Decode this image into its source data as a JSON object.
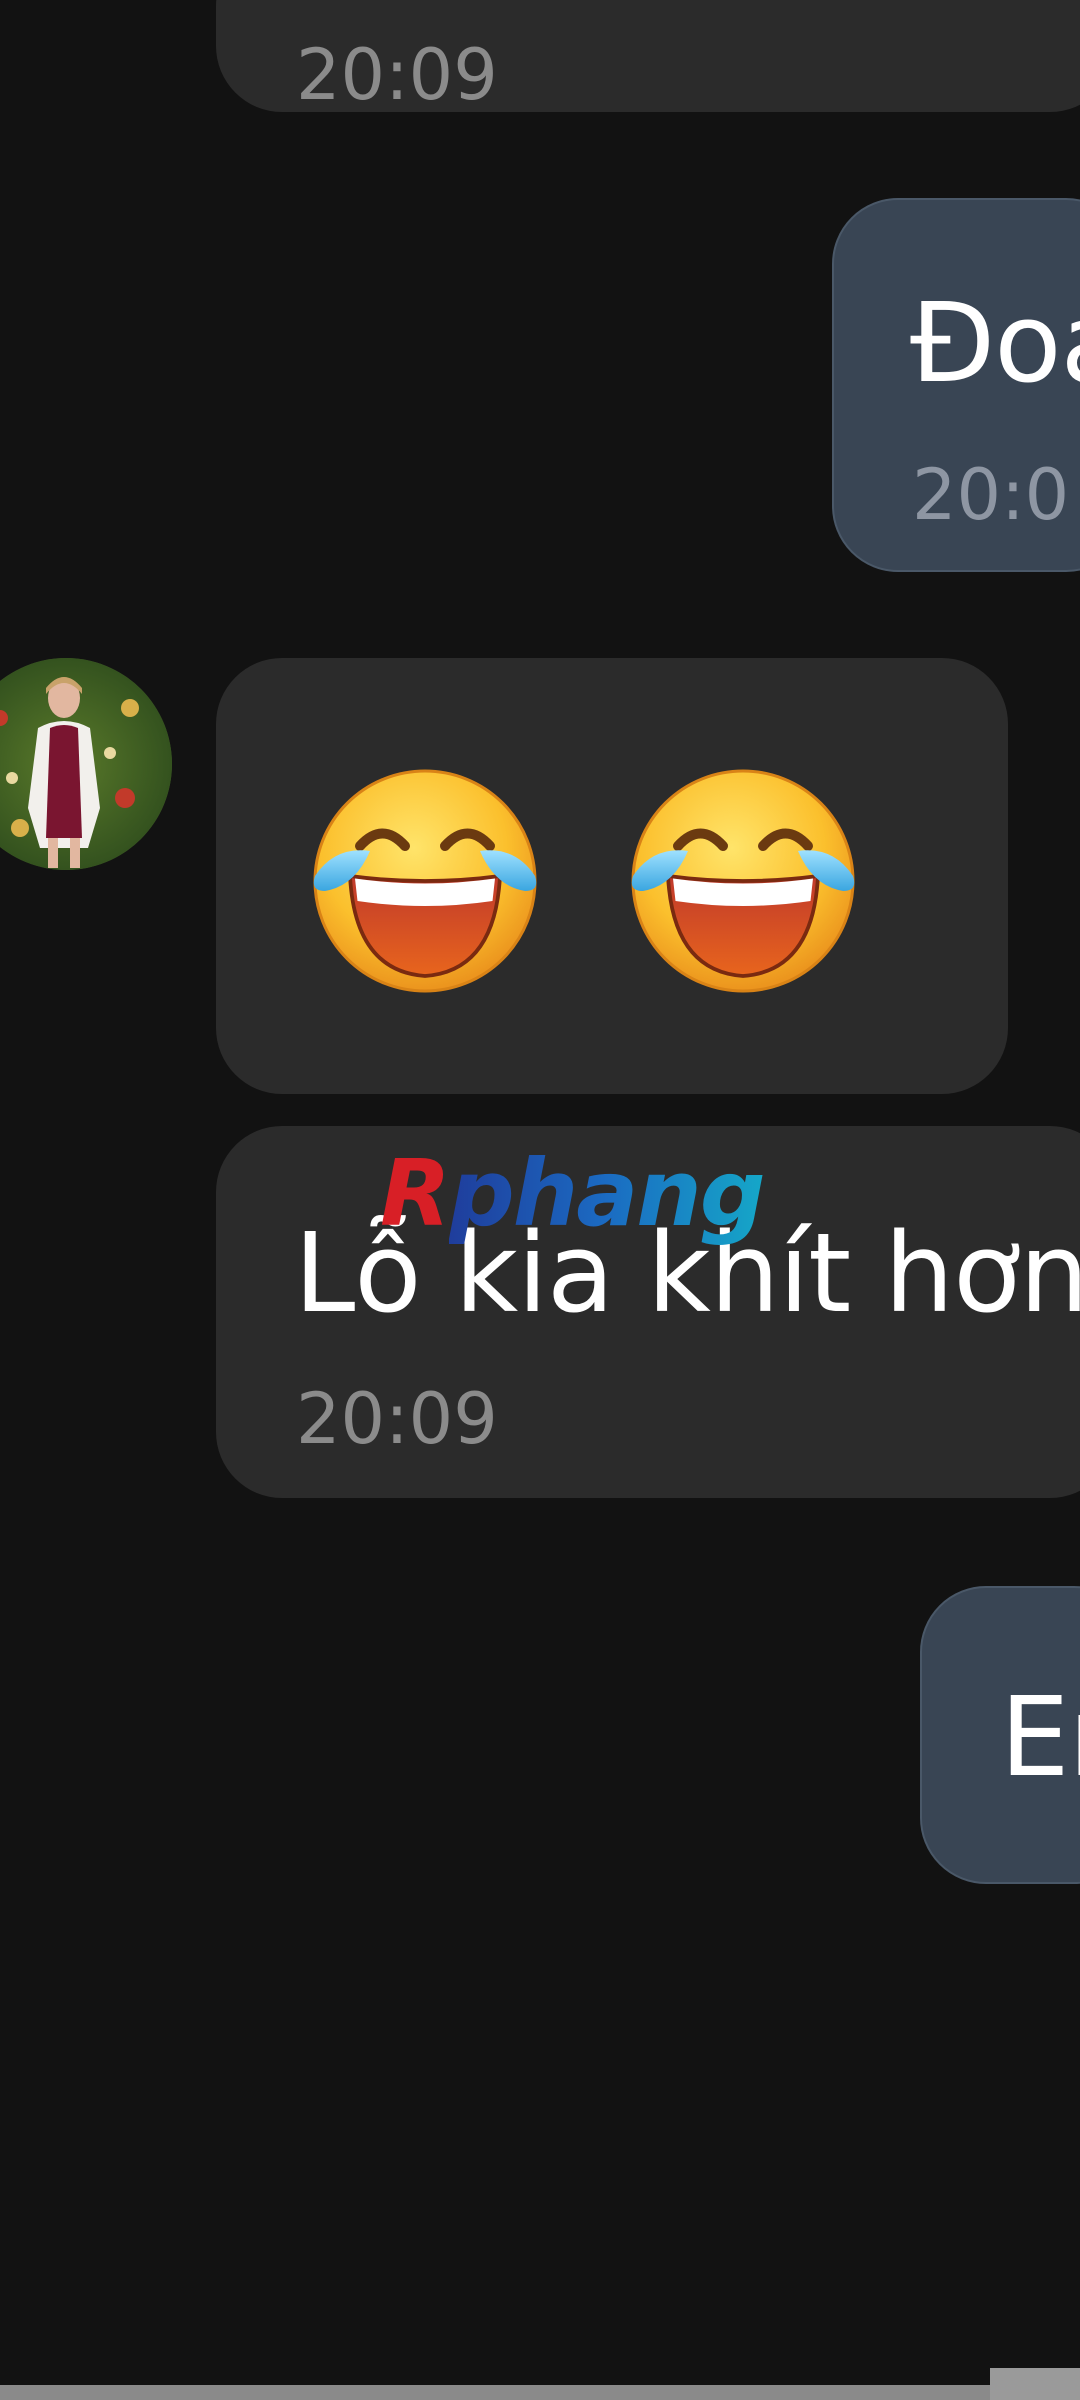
{
  "messages": [
    {
      "side": "incoming",
      "time": "20:09"
    },
    {
      "side": "outgoing",
      "text": "Đoa",
      "time": "20:0"
    },
    {
      "side": "incoming",
      "emojis": [
        "face-with-tears-of-joy",
        "face-with-tears-of-joy"
      ]
    },
    {
      "side": "incoming",
      "text": "Lỗ kia khít hơn",
      "time": "20:09"
    },
    {
      "side": "outgoing",
      "text": "Er"
    }
  ],
  "watermark": {
    "first": "R",
    "rest": "phang"
  },
  "colors": {
    "background": "#121212",
    "incoming_bubble": "#2b2b2b",
    "outgoing_bubble": "#394554",
    "time_text": "#8b8b8b"
  }
}
